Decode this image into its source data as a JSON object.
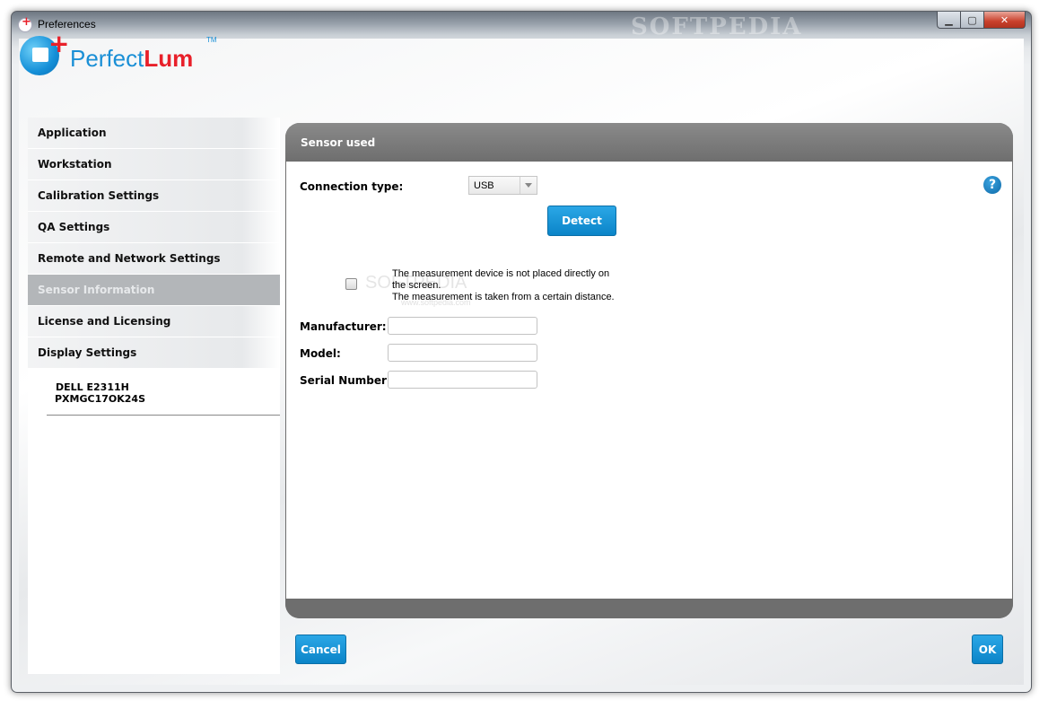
{
  "window": {
    "title": "Preferences",
    "title_watermark": "SOFTPEDIA",
    "controls": {
      "minimize": "▁",
      "maximize": "▢",
      "close": "✕"
    }
  },
  "logo": {
    "prefix": "Perfect",
    "suffix": "Lum",
    "tm": "TM"
  },
  "sidebar": {
    "items": [
      {
        "label": "Application"
      },
      {
        "label": "Workstation"
      },
      {
        "label": "Calibration Settings"
      },
      {
        "label": "QA Settings"
      },
      {
        "label": "Remote and Network Settings"
      },
      {
        "label": "Sensor Information",
        "active": true
      },
      {
        "label": "License and Licensing"
      },
      {
        "label": "Display Settings"
      }
    ],
    "display": {
      "model": "DELL E2311H",
      "serial": "PXMGC17OK24S"
    }
  },
  "panel": {
    "title": "Sensor used",
    "connection_label": "Connection type:",
    "connection_value": "USB",
    "detect_label": "Detect",
    "help_glyph": "?",
    "checkbox_checked": false,
    "checkbox_text_1": "The measurement device is not placed directly on the screen.",
    "checkbox_text_2": "The measurement is taken from a certain distance.",
    "watermark": "SOFTPEDIA",
    "watermark_url": "www.softpedia.com",
    "manufacturer_label": "Manufacturer:",
    "manufacturer_value": "",
    "model_label": "Model:",
    "model_value": "",
    "serial_label": "Serial Number:",
    "serial_value": ""
  },
  "footer": {
    "cancel_label": "Cancel",
    "ok_label": "OK"
  },
  "colors": {
    "accent": "#0b84c8",
    "active_nav": "#b3b6b9",
    "panel_header": "#6f6f6f"
  }
}
